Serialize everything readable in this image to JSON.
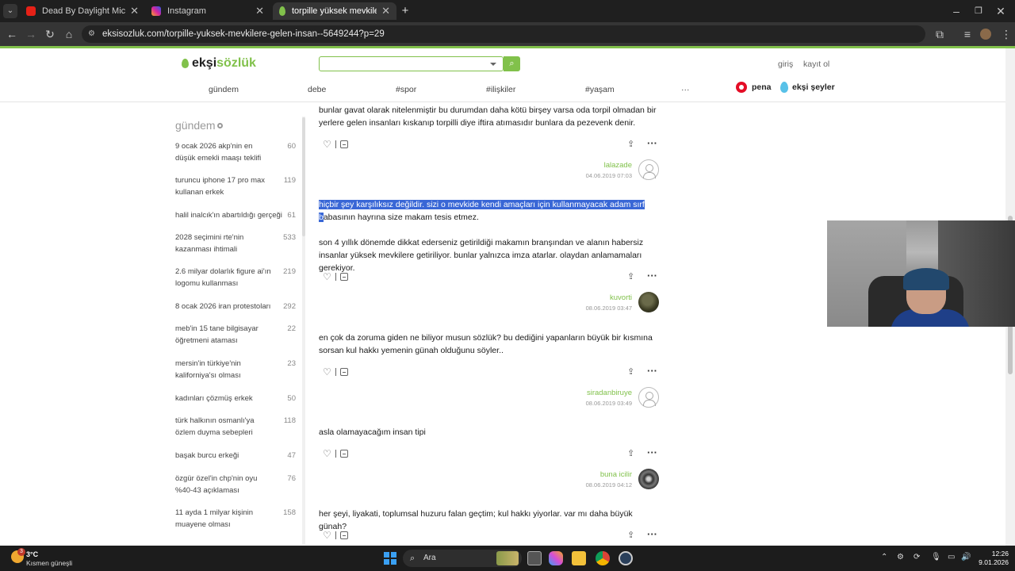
{
  "browser": {
    "tabs": [
      {
        "title": "Dead By Daylight Michael Myers",
        "favicon_color": "#e62117"
      },
      {
        "title": "Instagram",
        "favicon_color": "#d6249f"
      },
      {
        "title": "torpille yüksek mevkilere gelen",
        "favicon_color": "#81c14b"
      }
    ],
    "new_tab": "+",
    "url": "eksisozluk.com/torpille-yuksek-mevkilere-gelen-insan--5649244?p=29"
  },
  "site": {
    "logo_pre": "ekşi",
    "logo_post": "sözlük",
    "accent": "#81c14b",
    "login": "giriş",
    "register": "kayıt ol",
    "nav": [
      "gündem",
      "debe",
      "#spor",
      "#ilişkiler",
      "#yaşam",
      "···"
    ],
    "pena": "pena",
    "eksi_seyler": "ekşi şeyler"
  },
  "sidebar": {
    "heading": "gündem",
    "items": [
      {
        "title": "9 ocak 2026 akp'nin en düşük emekli maaşı teklifi",
        "count": "60"
      },
      {
        "title": "turuncu iphone 17 pro max kullanan erkek",
        "count": "119"
      },
      {
        "title": "halil inalcık'ın abartıldığı gerçeği",
        "count": "61"
      },
      {
        "title": "2028 seçimini rte'nin kazanması ihtimali",
        "count": "533"
      },
      {
        "title": "2.6 milyar dolarlık figure ai'ın logomu kullanması",
        "count": "219"
      },
      {
        "title": "8 ocak 2026 iran protestoları",
        "count": "292"
      },
      {
        "title": "meb'in 15 tane bilgisayar öğretmeni ataması",
        "count": "22"
      },
      {
        "title": "mersin'in türkiye'nin kaliforniya'sı olması",
        "count": "23"
      },
      {
        "title": "kadınları çözmüş erkek",
        "count": "50"
      },
      {
        "title": "türk halkının osmanlı'ya özlem duyma sebepleri",
        "count": "118"
      },
      {
        "title": "başak burcu erkeği",
        "count": "47"
      },
      {
        "title": "özgür özel'in chp'nin oyu %40-43 açıklaması",
        "count": "76"
      },
      {
        "title": "11 ayda 1 milyar kişinin muayene olması",
        "count": "158"
      }
    ]
  },
  "entries": [
    {
      "text": "bunlar gavat olarak nitelenmiştir bu durumdan daha kötü birşey varsa oda torpil olmadan bir yerlere gelen insanları kıskanıp torpilli diye iftira atımasıdır bunlara da pezevenk denir.",
      "author": "lalazade",
      "date": "04.06.2019 07:03"
    },
    {
      "text_hl": "hiçbir şey karşılıksız değildir. sizi o mevkide kendi amaçları için kullanmayacak adam sırf",
      "text_hl2": "b",
      "text_rest": "abasının hayrına size makam tesis etmez.",
      "text_p2": "son 4 yıllık dönemde dikkat ederseniz getirildiği makamın branşından ve alanın habersiz insanlar yüksek mevkilere getiriliyor. bunlar yalnızca imza atarlar. olaydan anlamamaları gerekiyor.",
      "author": "kuvorti",
      "date": "08.06.2019 03:47"
    },
    {
      "text": "en çok da zoruma giden ne biliyor musun sözlük? bu dediğini yapanların büyük bir kısmına sorsan kul hakkı yemenin günah olduğunu söyler..",
      "author": "siradanbiruye",
      "date": "08.06.2019 03:49"
    },
    {
      "text": "asla olamayacağım insan tipi",
      "author": "buna icilir",
      "date": "08.06.2019 04:12"
    },
    {
      "text": "her şeyi, liyakati, toplumsal huzuru falan geçtim; kul hakkı yiyorlar. var mı daha büyük günah?"
    }
  ],
  "taskbar": {
    "temp": "3°C",
    "weather": "Kısmen güneşli",
    "weather_badge": "3",
    "search": "Ara",
    "time": "12:26",
    "date": "9.01.2026"
  }
}
